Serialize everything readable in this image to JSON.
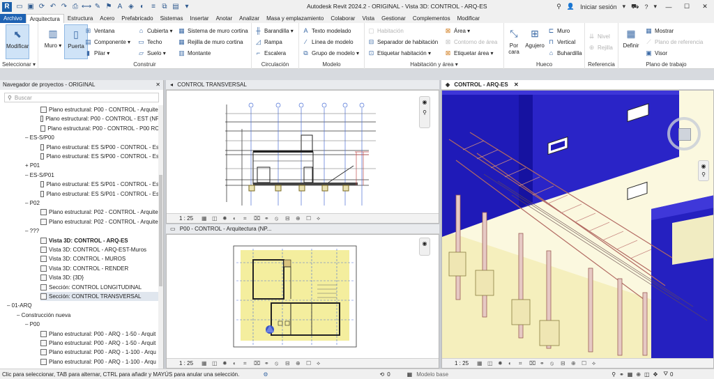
{
  "titlebar": {
    "app_title": "Autodesk Revit 2024.2 - ORIGINAL - Vista 3D: CONTROL - ARQ-ES",
    "signin": "Iniciar sesión",
    "logo": "R"
  },
  "menu": {
    "tabs": [
      "Archivo",
      "Arquitectura",
      "Estructura",
      "Acero",
      "Prefabricado",
      "Sistemas",
      "Insertar",
      "Anotar",
      "Analizar",
      "Masa y emplazamiento",
      "Colaborar",
      "Vista",
      "Gestionar",
      "Complementos",
      "Modificar"
    ]
  },
  "ribbon": {
    "seleccionar": {
      "modificar": "Modificar",
      "label": "Seleccionar ▾"
    },
    "construir": {
      "muro": "Muro",
      "puerta": "Puerta",
      "ventana": "Ventana",
      "componente": "Componente",
      "pilar": "Pilar",
      "cubierta": "Cubierta",
      "techo": "Techo",
      "suelo": "Suelo",
      "sistema_muro_cortina": "Sistema de muro cortina",
      "rejilla_muro_cortina": "Rejilla de muro cortina",
      "montante": "Montante",
      "label": "Construir"
    },
    "circulacion": {
      "barandilla": "Barandilla",
      "rampa": "Rampa",
      "escalera": "Escalera",
      "label": "Circulación"
    },
    "modelo": {
      "texto_modelado": "Texto modelado",
      "linea_modelo": "Línea de modelo",
      "grupo_modelo": "Grupo de modelo",
      "label": "Modelo"
    },
    "habitacion": {
      "habitacion": "Habitación",
      "separador": "Separador de habitación",
      "etiquetar_hab": "Etiquetar habitación",
      "area": "Área",
      "contorno_area": "Contorno de área",
      "etiquetar_area": "Etiquetar área",
      "label": "Habitación y área ▾"
    },
    "hueco": {
      "por_cara": "Por cara",
      "agujero": "Agujero",
      "muro": "Muro",
      "vertical": "Vertical",
      "buhardilla": "Buhardilla",
      "label": "Hueco"
    },
    "referencia": {
      "nivel": "Nivel",
      "rejilla": "Rejilla",
      "label": "Referencia"
    },
    "plano": {
      "definir": "Definir",
      "mostrar": "Mostrar",
      "plano_referencia": "Plano de referencia",
      "visor": "Visor",
      "label": "Plano de trabajo"
    }
  },
  "browser": {
    "header": "Navegador de proyectos - ORIGINAL",
    "search_placeholder": "Buscar",
    "rows": [
      {
        "indent": 58,
        "icon": true,
        "text": "Plano estructural: P00 - CONTROL - Arquite"
      },
      {
        "indent": 58,
        "icon": true,
        "text": "Plano estructural: P00 - CONTROL - EST (NF"
      },
      {
        "indent": 58,
        "icon": true,
        "text": "Plano estructural: P00 - CONTROL - P00 RC"
      },
      {
        "indent": 36,
        "icon": false,
        "text": "– ES-S/P00"
      },
      {
        "indent": 58,
        "icon": true,
        "text": "Plano estructural: ES S/P00 - CONTROL - Es"
      },
      {
        "indent": 58,
        "icon": true,
        "text": "Plano estructural: ES S/P00 - CONTROL - Es"
      },
      {
        "indent": 36,
        "icon": false,
        "text": "+ P01"
      },
      {
        "indent": 36,
        "icon": false,
        "text": "– ES-S/P01"
      },
      {
        "indent": 58,
        "icon": true,
        "text": "Plano estructural: ES S/P01 - CONTROL - Es"
      },
      {
        "indent": 58,
        "icon": true,
        "text": "Plano estructural: ES S/P01 - CONTROL - Es"
      },
      {
        "indent": 36,
        "icon": false,
        "text": "– P02"
      },
      {
        "indent": 58,
        "icon": true,
        "text": "Plano estructural: P02 - CONTROL - Arquite"
      },
      {
        "indent": 58,
        "icon": true,
        "text": "Plano estructural: P02 - CONTROL - Arquite"
      },
      {
        "indent": 36,
        "icon": false,
        "text": "– ???"
      },
      {
        "indent": 58,
        "icon": true,
        "text": "Vista 3D: CONTROL - ARQ-ES",
        "bold": true
      },
      {
        "indent": 58,
        "icon": true,
        "text": "Vista 3D: CONTROL - ARQ-EST-Muros"
      },
      {
        "indent": 58,
        "icon": true,
        "text": "Vista 3D: CONTROL - MUROS"
      },
      {
        "indent": 58,
        "icon": true,
        "text": "Vista 3D: CONTROL - RENDER"
      },
      {
        "indent": 58,
        "icon": true,
        "text": "Vista 3D: {3D}"
      },
      {
        "indent": 58,
        "icon": true,
        "text": "Sección: CONTROL LONGITUDINAL"
      },
      {
        "indent": 58,
        "icon": true,
        "text": "Sección: CONTROL TRANSVERSAL",
        "sel": true
      },
      {
        "indent": 10,
        "icon": false,
        "text": "– 01-ARQ"
      },
      {
        "indent": 24,
        "icon": false,
        "text": "– Construcción nueva"
      },
      {
        "indent": 36,
        "icon": false,
        "text": "– P00"
      },
      {
        "indent": 58,
        "icon": true,
        "text": "Plano estructural: P00 - ARQ - 1-50 - Arquit"
      },
      {
        "indent": 58,
        "icon": true,
        "text": "Plano estructural: P00 - ARQ - 1-50 - Arquit"
      },
      {
        "indent": 58,
        "icon": true,
        "text": "Plano estructural: P00 - ARQ - 1-100 - Arqu"
      },
      {
        "indent": 58,
        "icon": true,
        "text": "Plano estructural: P00 - ARQ - 1-100 - Arqu"
      }
    ]
  },
  "views": {
    "transversal_tab": "CONTROL TRANSVERSAL",
    "plan_tab": "P00 - CONTROL - Arquitectura (NP...",
    "view3d_tab": "CONTROL - ARQ-ES",
    "scale": "1 : 25"
  },
  "status": {
    "message": "Clic para seleccionar, TAB para alternar, CTRL para añadir y MAYÚS para anular una selección.",
    "count_a": "0",
    "model": "Modelo base",
    "count_b": "0"
  },
  "colors": {
    "wall_blue": "#1f1ab8",
    "floor_yellow": "#f6f2c6",
    "beam_pink": "#e6c9c4",
    "accent": "#1e62b3"
  }
}
